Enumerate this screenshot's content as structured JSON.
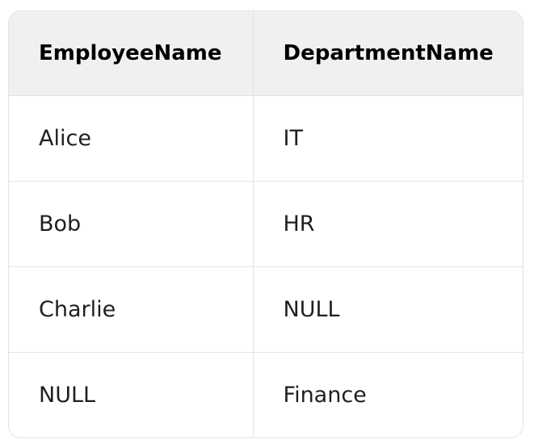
{
  "table": {
    "headers": [
      "EmployeeName",
      "DepartmentName"
    ],
    "rows": [
      [
        "Alice",
        "IT"
      ],
      [
        "Bob",
        "HR"
      ],
      [
        "Charlie",
        "NULL"
      ],
      [
        "NULL",
        "Finance"
      ]
    ]
  }
}
